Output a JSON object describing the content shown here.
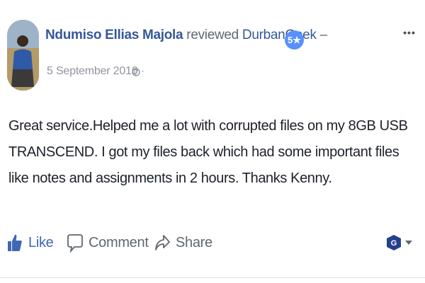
{
  "post": {
    "author": "Ndumiso Ellias Majola",
    "verb": "reviewed",
    "page_name": "DurbanGeek",
    "separator": "–",
    "rating_badge": "5★",
    "date": "5 September 2016 ·",
    "review_text": "Great service.Helped me a lot with corrupted files on my 8GB USB TRANSCEND. I got my files back which had some important files like notes and assignments in 2 hours. Thanks Kenny."
  },
  "actions": {
    "like": "Like",
    "comment": "Comment",
    "share": "Share"
  },
  "icons": {
    "more": "more-options-icon",
    "globe": "globe-icon",
    "like": "thumbs-up-icon",
    "comment": "speech-bubble-icon",
    "share": "share-arrow-icon",
    "profile": "page-profile-icon",
    "caret": "caret-down-icon"
  },
  "colors": {
    "link": "#365899",
    "like_blue": "#4267b2",
    "badge": "#5890ff",
    "muted": "#616770",
    "text": "#1d2129"
  }
}
